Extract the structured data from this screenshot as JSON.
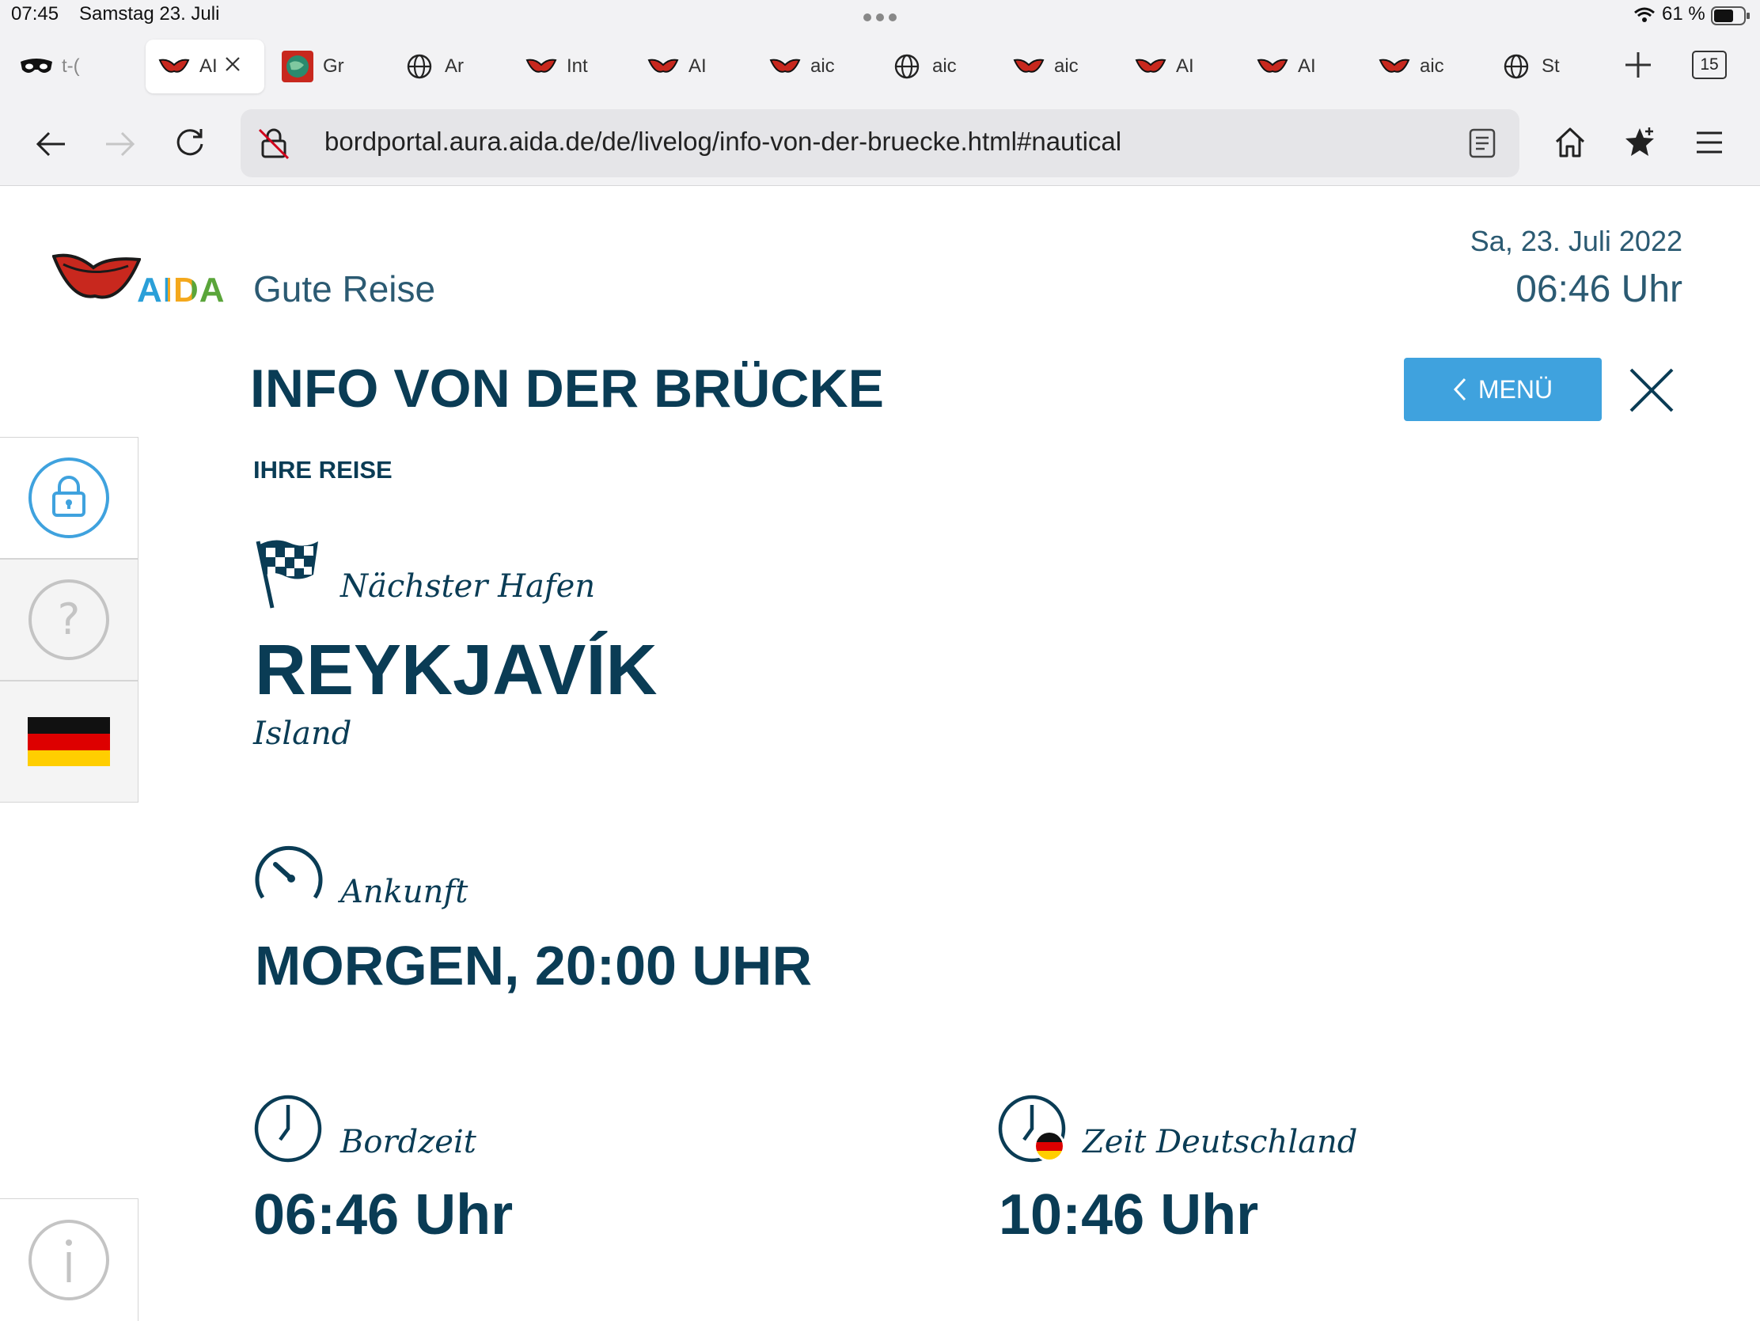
{
  "status_bar": {
    "time": "07:45",
    "date": "Samstag 23. Juli",
    "battery": "61 %"
  },
  "tabs": [
    {
      "label": "t-(",
      "icon": "private-mask-icon"
    },
    {
      "label": "AI",
      "icon": "aida-logo-icon",
      "active": true
    },
    {
      "label": "Gr",
      "icon": "globe-image-icon"
    },
    {
      "label": "Ar",
      "icon": "globe-icon"
    },
    {
      "label": "Int",
      "icon": "aida-logo-icon"
    },
    {
      "label": "AI",
      "icon": "aida-logo-icon"
    },
    {
      "label": "aic",
      "icon": "aida-logo-icon"
    },
    {
      "label": "aic",
      "icon": "globe-icon"
    },
    {
      "label": "aic",
      "icon": "aida-logo-icon"
    },
    {
      "label": "AI",
      "icon": "aida-logo-icon"
    },
    {
      "label": "AI",
      "icon": "aida-logo-icon"
    },
    {
      "label": "aic",
      "icon": "aida-logo-icon"
    },
    {
      "label": "St",
      "icon": "globe-icon"
    }
  ],
  "tab_count": "15",
  "url": "bordportal.aura.aida.de/de/livelog/info-von-der-bruecke.html#nautical",
  "header": {
    "brand": "AIDA",
    "tagline": "Gute Reise",
    "date": "Sa, 23. Juli 2022",
    "time": "06:46 Uhr"
  },
  "page": {
    "title": "INFO VON DER BRÜCKE",
    "menu_label": "MENÜ",
    "section": "IHRE REISE",
    "next_port_label": "Nächster Hafen",
    "next_port": "REYKJAVÍK",
    "country": "Island",
    "arrival_label": "Ankunft",
    "arrival": "MORGEN, 20:00 UHR",
    "board_time_label": "Bordzeit",
    "board_time": "06:46 Uhr",
    "germany_time_label": "Zeit Deutschland",
    "germany_time": "10:46 Uhr"
  },
  "colors": {
    "accent": "#3fa2de",
    "text": "#0a3c55",
    "aida_red": "#c8281e"
  }
}
